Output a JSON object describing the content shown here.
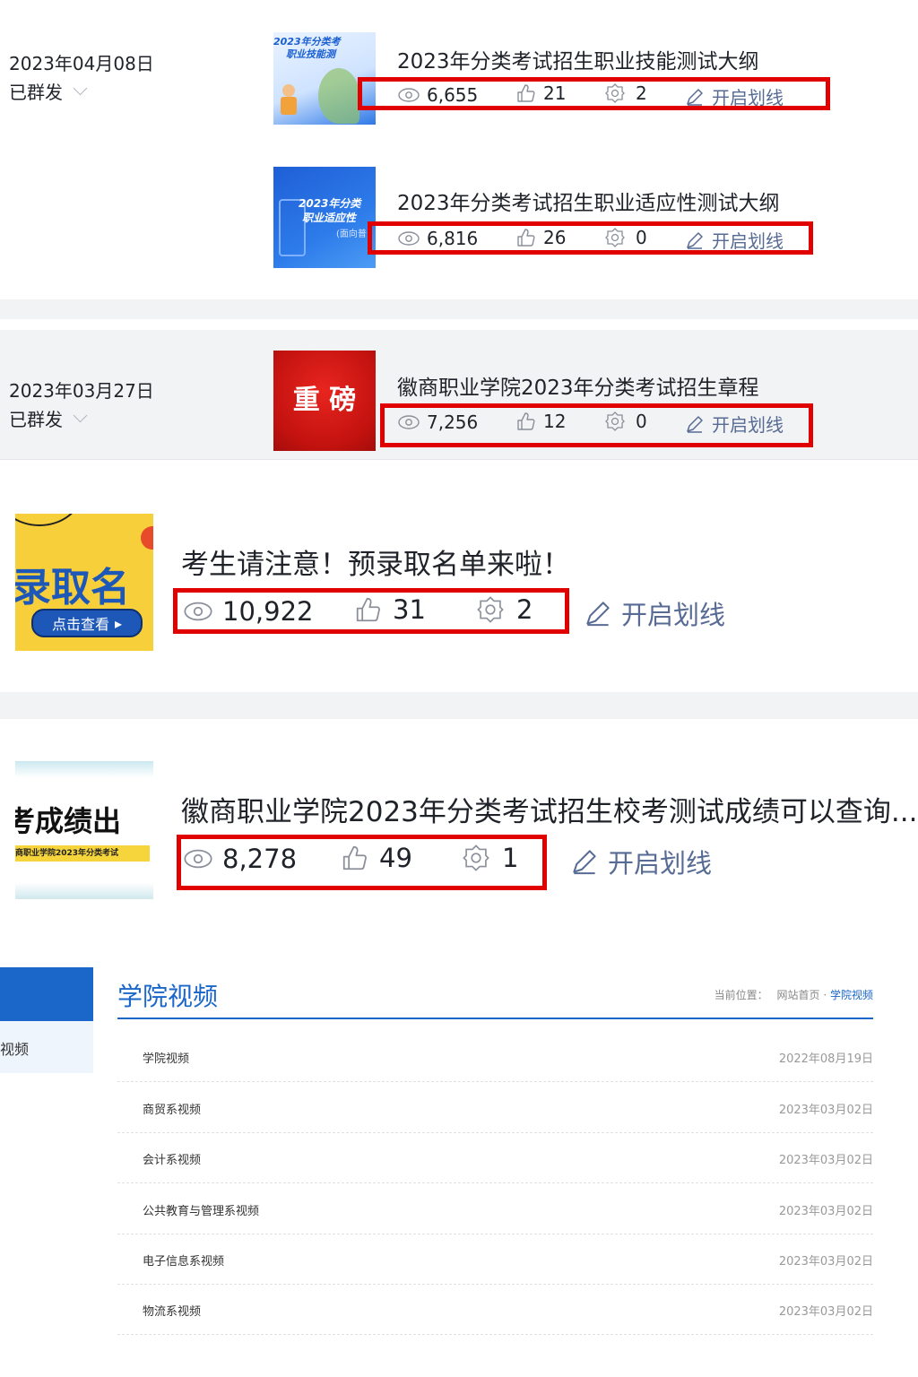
{
  "groups": [
    {
      "date": "2023年04月08日",
      "status": "已群发"
    },
    {
      "date": "2023年03月27日",
      "status": "已群发"
    }
  ],
  "articles": [
    {
      "title": "2023年分类考试招生职业技能测试大纲",
      "views": "6,655",
      "likes": "21",
      "shares": "2",
      "highlight": "开启划线",
      "thumb_text": [
        "2023年分类考",
        "职业技能测"
      ]
    },
    {
      "title": "2023年分类考试招生职业适应性测试大纲",
      "views": "6,816",
      "likes": "26",
      "shares": "0",
      "highlight": "开启划线",
      "thumb_text": [
        "2023年分类",
        "职业适应性",
        "(面向普"
      ]
    },
    {
      "title": "徽商职业学院2023年分类考试招生章程",
      "views": "7,256",
      "likes": "12",
      "shares": "0",
      "highlight": "开启划线",
      "thumb_text": [
        "重 磅"
      ]
    },
    {
      "title": "考生请注意！预录取名单来啦！",
      "views": "10,922",
      "likes": "31",
      "shares": "2",
      "highlight": "开启划线",
      "thumb_text": [
        "录取名",
        "点击查看"
      ]
    },
    {
      "title": "徽商职业学院2023年分类考试招生校考测试成绩可以查询...",
      "views": "8,278",
      "likes": "49",
      "shares": "1",
      "highlight": "开启划线",
      "thumb_text": [
        "考成绩出",
        "商职业学院2023年分类考试"
      ]
    }
  ],
  "video_section": {
    "sidebar_item": "视频",
    "title": "学院视频",
    "breadcrumb_prefix": "当前位置：",
    "breadcrumb_home": "网站首页",
    "breadcrumb_sep": "·",
    "breadcrumb_current": "学院视频",
    "items": [
      {
        "label": "学院视频",
        "date": "2022年08月19日"
      },
      {
        "label": "商贸系视频",
        "date": "2023年03月02日"
      },
      {
        "label": "会计系视频",
        "date": "2023年03月02日"
      },
      {
        "label": "公共教育与管理系视频",
        "date": "2023年03月02日"
      },
      {
        "label": "电子信息系视频",
        "date": "2023年03月02日"
      },
      {
        "label": "物流系视频",
        "date": "2023年03月02日"
      }
    ]
  },
  "colors": {
    "accent": "#1a66c9",
    "highlight_box": "#e10000",
    "link": "#576b95"
  },
  "icons": [
    "eye-icon",
    "thumb-up-icon",
    "share-gear-icon",
    "pencil-icon",
    "chevron-down-icon"
  ]
}
